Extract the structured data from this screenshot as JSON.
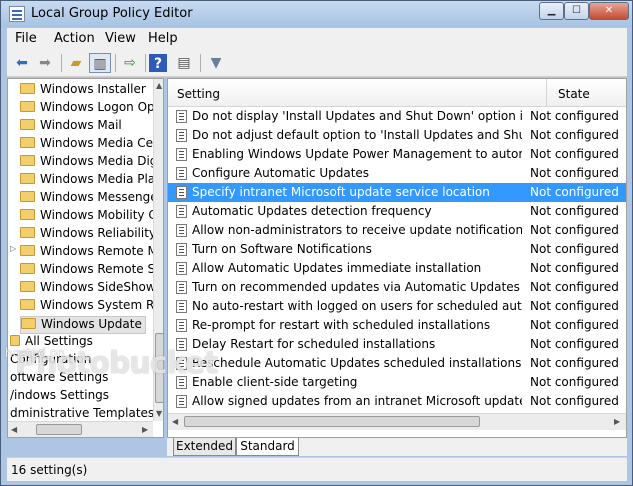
{
  "window": {
    "title": "Local Group Policy Editor"
  },
  "menu": [
    "File",
    "Action",
    "View",
    "Help"
  ],
  "tree": [
    "Windows Installer",
    "Windows Logon Op",
    "Windows Mail",
    "Windows Media Cer",
    "Windows Media Dig",
    "Windows Media Pla",
    "Windows Messenge",
    "Windows Mobility C",
    "Windows Reliability",
    "Windows Remote M",
    "Windows Remote Sh",
    "Windows SideShow",
    "Windows System Re",
    "Windows Update",
    "All Settings",
    "Configuration",
    "oftware Settings",
    "/indows Settings",
    "dministrative Templates"
  ],
  "columns": {
    "setting": "Setting",
    "state": "State"
  },
  "rows": [
    {
      "name": "Do not display 'Install Updates and Shut Down' option in Sh...",
      "state": "Not configured"
    },
    {
      "name": "Do not adjust default option to 'Install Updates and Shut Do...",
      "state": "Not configured"
    },
    {
      "name": "Enabling Windows Update Power Management to automati...",
      "state": "Not configured"
    },
    {
      "name": "Configure Automatic Updates",
      "state": "Not configured"
    },
    {
      "name": "Specify intranet Microsoft update service location",
      "state": "Not configured"
    },
    {
      "name": "Automatic Updates detection frequency",
      "state": "Not configured"
    },
    {
      "name": "Allow non-administrators to receive update notifications",
      "state": "Not configured"
    },
    {
      "name": "Turn on Software Notifications",
      "state": "Not configured"
    },
    {
      "name": "Allow Automatic Updates immediate installation",
      "state": "Not configured"
    },
    {
      "name": "Turn on recommended updates via Automatic Updates",
      "state": "Not configured"
    },
    {
      "name": "No auto-restart with logged on users for scheduled automat...",
      "state": "Not configured"
    },
    {
      "name": "Re-prompt for restart with scheduled installations",
      "state": "Not configured"
    },
    {
      "name": "Delay Restart for scheduled installations",
      "state": "Not configured"
    },
    {
      "name": "Reschedule Automatic Updates scheduled installations",
      "state": "Not configured"
    },
    {
      "name": "Enable client-side targeting",
      "state": "Not configured"
    },
    {
      "name": "Allow signed updates from an intranet Microsoft update ser...",
      "state": "Not configured"
    }
  ],
  "tabs": {
    "extended": "Extended",
    "standard": "Standard"
  },
  "status": "16 setting(s)",
  "watermark": {
    "line1": "Photobucket",
    "line2": "hosted on"
  },
  "colors": {
    "selection": "#3399ff",
    "folder": "#f2cf6b"
  },
  "icons": [
    "back-arrow-icon",
    "forward-arrow-icon",
    "up-folder-icon",
    "show-tree-icon",
    "export-icon",
    "help-icon",
    "properties-icon",
    "filter-icon"
  ]
}
